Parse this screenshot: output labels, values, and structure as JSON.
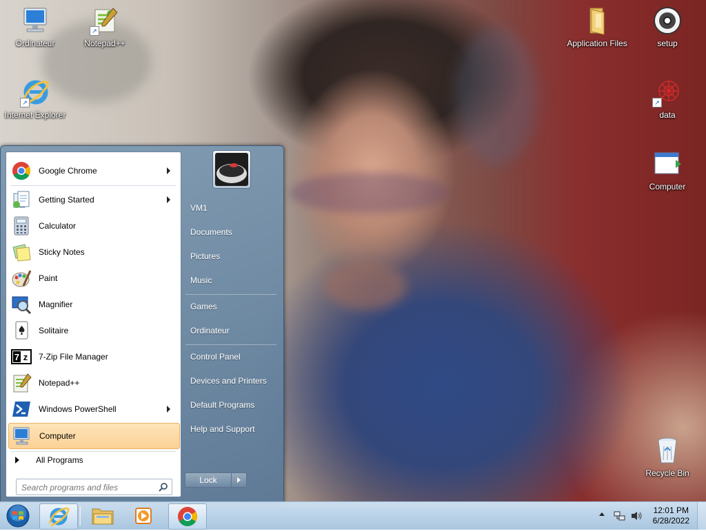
{
  "desktop": {
    "icons": [
      {
        "label": "Ordinateur"
      },
      {
        "label": "Notepad++"
      },
      {
        "label": "Internet Explorer"
      },
      {
        "label": "Application Files"
      },
      {
        "label": "setup"
      },
      {
        "label": "data"
      },
      {
        "label": "Computer"
      },
      {
        "label": "Recycle Bin"
      }
    ]
  },
  "start_menu": {
    "programs": [
      {
        "label": "Google Chrome",
        "has_submenu": true,
        "icon": "chrome-icon"
      },
      {
        "label": "Getting Started",
        "has_submenu": true,
        "icon": "getting-started-icon"
      },
      {
        "label": "Calculator",
        "has_submenu": false,
        "icon": "calculator-icon"
      },
      {
        "label": "Sticky Notes",
        "has_submenu": false,
        "icon": "sticky-notes-icon"
      },
      {
        "label": "Paint",
        "has_submenu": false,
        "icon": "paint-icon"
      },
      {
        "label": "Magnifier",
        "has_submenu": false,
        "icon": "magnifier-icon"
      },
      {
        "label": "Solitaire",
        "has_submenu": false,
        "icon": "solitaire-icon"
      },
      {
        "label": "7-Zip File Manager",
        "has_submenu": false,
        "icon": "7zip-icon"
      },
      {
        "label": "Notepad++",
        "has_submenu": false,
        "icon": "notepadpp-icon"
      },
      {
        "label": "Windows PowerShell",
        "has_submenu": true,
        "icon": "powershell-icon"
      },
      {
        "label": "Computer",
        "has_submenu": false,
        "icon": "computer-icon",
        "highlighted": true
      }
    ],
    "all_programs": "All Programs",
    "search_placeholder": "Search programs and files",
    "right_items": [
      {
        "label": "VM1"
      },
      {
        "label": "Documents"
      },
      {
        "label": "Pictures"
      },
      {
        "label": "Music"
      },
      {
        "label": "Games"
      },
      {
        "label": "Ordinateur"
      },
      {
        "label": "Control Panel"
      },
      {
        "label": "Devices and Printers"
      },
      {
        "label": "Default Programs"
      },
      {
        "label": "Help and Support"
      }
    ],
    "lock_label": "Lock"
  },
  "taskbar": {
    "time": "12:01 PM",
    "date": "6/28/2022"
  }
}
